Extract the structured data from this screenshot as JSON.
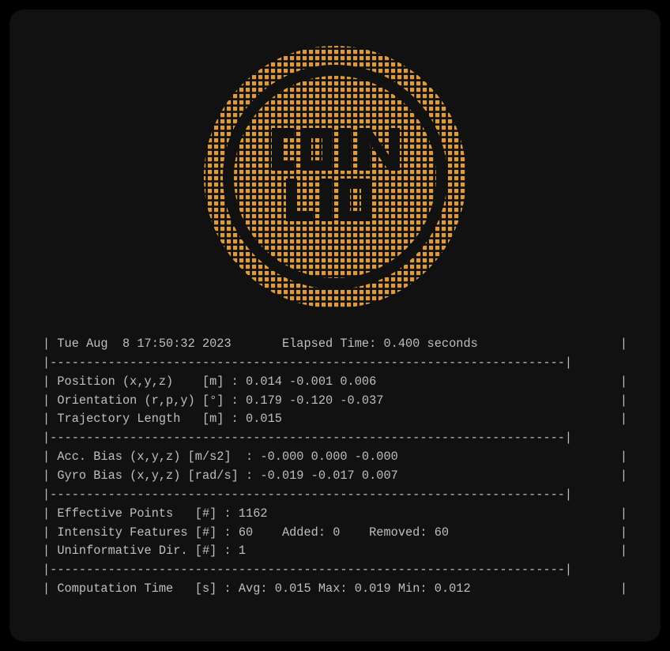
{
  "header": {
    "timestamp": "Tue Aug  8 17:50:32 2023",
    "elapsed_label": "Elapsed Time:",
    "elapsed_value": "0.400 seconds"
  },
  "state": {
    "position_label": "Position (x,y,z)    [m] :",
    "position_value": "0.014 -0.001 0.006",
    "orientation_label": "Orientation (r,p,y) [°] :",
    "orientation_value": "0.179 -0.120 -0.037",
    "trajlen_label": "Trajectory Length   [m] :",
    "trajlen_value": "0.015"
  },
  "bias": {
    "acc_label": "Acc. Bias (x,y,z) [m/s2]  :",
    "acc_value": "-0.000 0.000 -0.000",
    "gyro_label": "Gyro Bias (x,y,z) [rad/s] :",
    "gyro_value": "-0.019 -0.017 0.007"
  },
  "features": {
    "eff_label": "Effective Points   [#] :",
    "eff_value": "1162",
    "int_label": "Intensity Features [#] :",
    "int_value": "60",
    "int_added_label": "Added:",
    "int_added_value": "0",
    "int_removed_label": "Removed:",
    "int_removed_value": "60",
    "unin_label": "Uninformative Dir. [#] :",
    "unin_value": "1"
  },
  "time": {
    "label": "Computation Time   [s] :",
    "avg_label": "Avg:",
    "avg_value": "0.015",
    "max_label": "Max:",
    "max_value": "0.019",
    "min_label": "Min:",
    "min_value": "0.012"
  },
  "divider": "|-----------------------------------------------------------------------|",
  "logo_name": "COIN LIO"
}
